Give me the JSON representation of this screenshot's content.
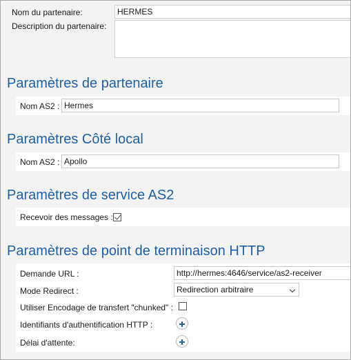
{
  "top": {
    "partner_name_label": "Nom du partenaire:",
    "partner_name_value": "HERMES",
    "partner_desc_label": "Description du partenaire:",
    "partner_desc_value": ""
  },
  "partner_params": {
    "heading": "Paramètres de partenaire",
    "as2_name_label": "Nom AS2 :",
    "as2_name_value": "Hermes"
  },
  "local_params": {
    "heading": "Paramètres Côté local",
    "as2_name_label": "Nom AS2 :",
    "as2_name_value": "Apollo"
  },
  "as2_service": {
    "heading": "Paramètres de service AS2",
    "receive_label": "Recevoir des messages :",
    "receive_checked": true
  },
  "http_endpoint": {
    "heading": "Paramètres de point de terminaison HTTP",
    "url_label": "Demande URL :",
    "url_value": "http://hermes:4646/service/as2-receiver",
    "redirect_label": "Mode Redirect :",
    "redirect_value": "Redirection arbitraire",
    "chunked_label": "Utiliser Encodage de transfert \"chunked\" :",
    "chunked_checked": false,
    "auth_label": "Identifiants d'authentification HTTP :",
    "timeout_label": "Délai d'attente:"
  },
  "colors": {
    "heading": "#1f5fa6",
    "background": "#f3f3f3",
    "panel": "#ffffff"
  }
}
